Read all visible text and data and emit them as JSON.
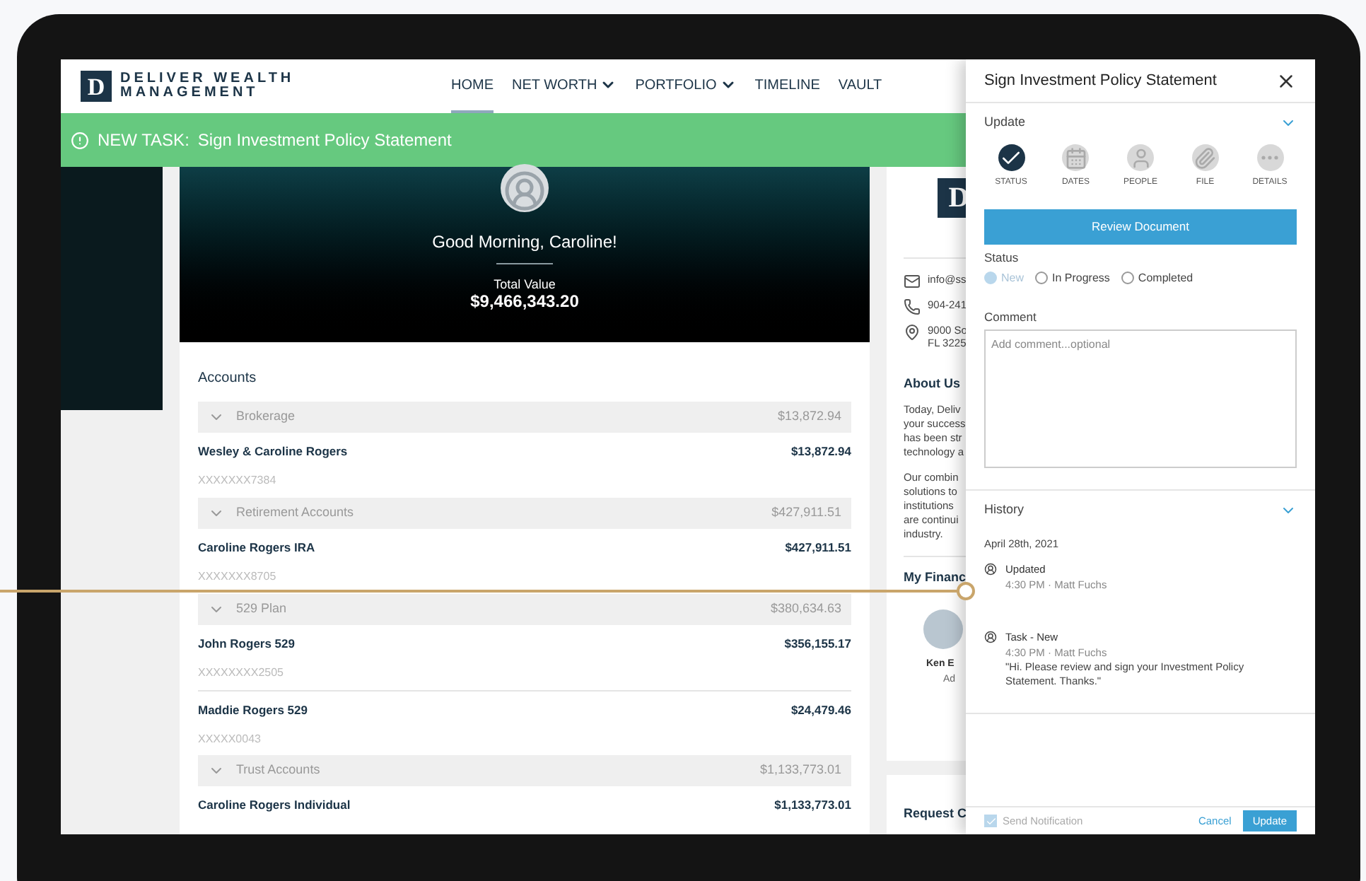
{
  "brand": {
    "mark": "D",
    "name_lines": [
      "DELIVER WEALTH",
      "MANAGEMENT"
    ]
  },
  "nav": [
    {
      "label": "HOME",
      "selected": true,
      "dropdown": false
    },
    {
      "label": "NET WORTH",
      "selected": false,
      "dropdown": true
    },
    {
      "label": "PORTFOLIO",
      "selected": false,
      "dropdown": true
    },
    {
      "label": "TIMELINE",
      "selected": false,
      "dropdown": false
    },
    {
      "label": "VAULT",
      "selected": false,
      "dropdown": false
    }
  ],
  "banner": {
    "label": "NEW TASK:",
    "text": "Sign Investment Policy Statement"
  },
  "hero": {
    "greeting": "Good Morning, Caroline!",
    "total_label": "Total Value",
    "total_value": "$9,466,343.20"
  },
  "accounts": {
    "title": "Accounts",
    "groups": [
      {
        "name": "Brokerage",
        "total": "$13,872.94",
        "expanded": true,
        "accounts": [
          {
            "name": "Wesley & Caroline Rogers",
            "value": "$13,872.94",
            "number": "XXXXXXX7384"
          }
        ]
      },
      {
        "name": "Retirement Accounts",
        "total": "$427,911.51",
        "expanded": true,
        "accounts": [
          {
            "name": "Caroline Rogers IRA",
            "value": "$427,911.51",
            "number": "XXXXXXX8705"
          }
        ]
      },
      {
        "name": "529 Plan",
        "total": "$380,634.63",
        "expanded": true,
        "accounts": [
          {
            "name": "John Rogers 529",
            "value": "$356,155.17",
            "number": "XXXXXXXX2505"
          },
          {
            "name": "Maddie Rogers 529",
            "value": "$24,479.46",
            "number": "XXXXX0043"
          }
        ]
      },
      {
        "name": "Trust Accounts",
        "total": "$1,133,773.01",
        "expanded": true,
        "accounts": [
          {
            "name": "Caroline Rogers Individual",
            "value": "$1,133,773.01"
          }
        ]
      }
    ]
  },
  "side_card": {
    "logo": "D",
    "contacts": [
      {
        "kind": "email",
        "lines": [
          "info@ss"
        ]
      },
      {
        "kind": "phone",
        "lines": [
          "904-241"
        ]
      },
      {
        "kind": "address",
        "lines": [
          "9000 So",
          "FL 3225"
        ]
      }
    ],
    "about": {
      "title": "About Us",
      "paragraphs": [
        [
          "Today, Deliv",
          "your success",
          "has been str",
          "technology a"
        ],
        [
          "Our combin",
          "solutions to",
          "institutions",
          "are continui",
          "industry."
        ]
      ]
    },
    "advisor": {
      "title": "My Financ",
      "name": "Ken E",
      "role": "Ad"
    },
    "request": {
      "title": "Request C"
    }
  },
  "panel": {
    "title": "Sign Investment Policy Statement",
    "update": {
      "title": "Update",
      "expanded": true,
      "tabs": [
        {
          "kind": "status",
          "label": "STATUS",
          "selected": true
        },
        {
          "kind": "dates",
          "label": "DATES",
          "selected": false
        },
        {
          "kind": "people",
          "label": "PEOPLE",
          "selected": false
        },
        {
          "kind": "file",
          "label": "FILE",
          "selected": false
        },
        {
          "kind": "details",
          "label": "DETAILS",
          "selected": false
        }
      ],
      "button": "Review Document",
      "status": {
        "label": "Status",
        "options": [
          {
            "label": "New",
            "selected": true,
            "disabled": true
          },
          {
            "label": "In Progress",
            "selected": false,
            "disabled": false
          },
          {
            "label": "Completed",
            "selected": false,
            "disabled": false
          }
        ]
      },
      "comment": {
        "label": "Comment",
        "placeholder": "Add comment...optional"
      }
    },
    "history": {
      "title": "History",
      "expanded": true,
      "date": "April 28th, 2021",
      "entries": [
        {
          "title": "Updated",
          "meta": "4:30 PM · Matt Fuchs"
        },
        {
          "title": "Task - New",
          "meta": "4:30 PM · Matt Fuchs",
          "message": "\"Hi. Please review and sign your Investment Policy Statement. Thanks.\""
        }
      ]
    },
    "footer": {
      "notify": {
        "label": "Send Notification",
        "checked": true,
        "disabled": true
      },
      "cancel": "Cancel",
      "submit": "Update"
    }
  }
}
